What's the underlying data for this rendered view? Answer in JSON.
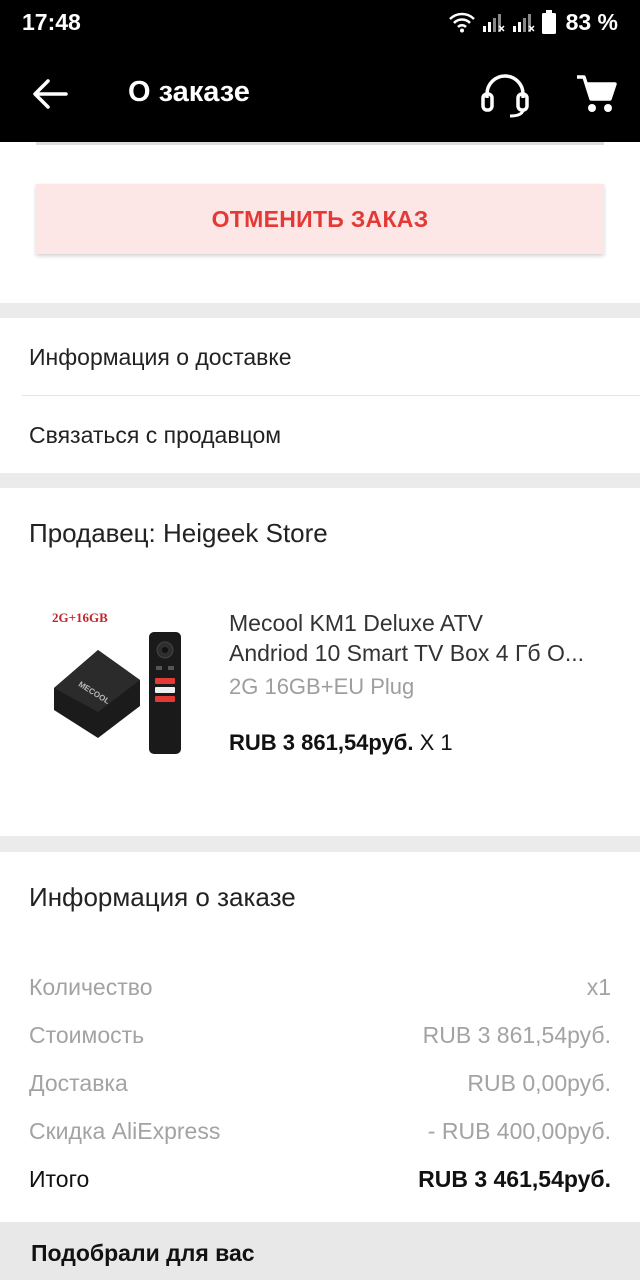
{
  "status_bar": {
    "time": "17:48",
    "battery": "83 %",
    "icons": [
      "wifi-icon",
      "signal-icon",
      "signal-icon",
      "battery-icon"
    ]
  },
  "header": {
    "title": "О заказе",
    "back_icon": "arrow-left-icon",
    "support_icon": "headset-icon",
    "cart_icon": "cart-icon"
  },
  "cancel_order": {
    "label": "ОТМЕНИТЬ ЗАКАЗ"
  },
  "links": {
    "delivery_info": "Информация о доставке",
    "contact_seller": "Связаться с продавцом"
  },
  "seller": {
    "title": "Продавец: Heigeek Store",
    "product": {
      "image_badge": "2G+16GB",
      "brand_on_box": "MECOOL",
      "name_line1": "Mecool KM1 Deluxe ATV",
      "name_line2": "Andriod 10 Smart TV Box 4 Гб О...",
      "variant": "2G 16GB+EU Plug",
      "price": "RUB 3 861,54руб.",
      "quantity": "X 1"
    }
  },
  "order_info": {
    "title": "Информация о заказе",
    "rows": [
      {
        "label": "Количество",
        "value": "x1"
      },
      {
        "label": "Стоимость",
        "value": "RUB 3 861,54руб."
      },
      {
        "label": "Доставка",
        "value": "RUB 0,00руб."
      },
      {
        "label": "Скидка AliExpress",
        "value": "- RUB 400,00руб."
      }
    ],
    "total": {
      "label": "Итого",
      "value": "RUB 3 461,54руб."
    }
  },
  "recommendations": {
    "title": "Подобрали для вас"
  },
  "colors": {
    "cancel_text": "#e53935",
    "cancel_bg": "#fde6e6",
    "appbar_bg": "#000000"
  }
}
